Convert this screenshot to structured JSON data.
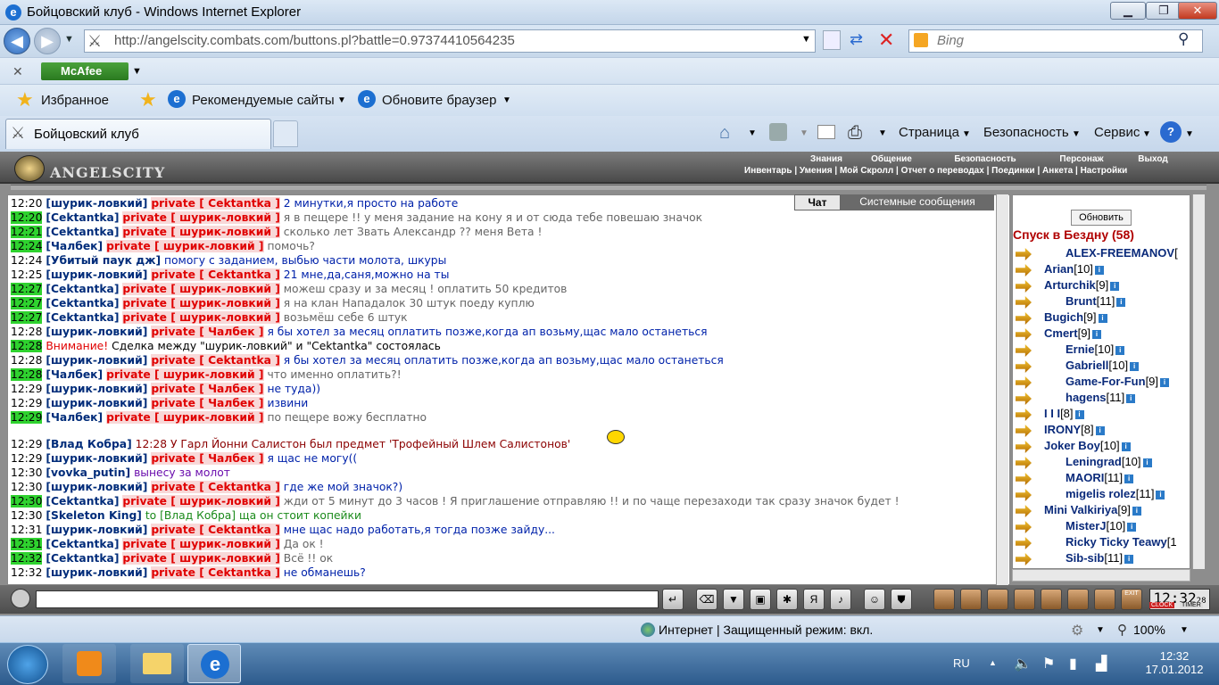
{
  "window": {
    "title": "Бойцовский клуб - Windows Internet Explorer"
  },
  "address": {
    "url": "http://angelscity.combats.com/buttons.pl?battle=0.97374410564235"
  },
  "search": {
    "placeholder": "Bing"
  },
  "toolbars": {
    "mcafee": "McAfee",
    "favorites": "Избранное",
    "suggested": "Рекомендуемые сайты",
    "update": "Обновите браузер"
  },
  "tab": {
    "title": "Бойцовский клуб"
  },
  "commandbar": {
    "page": "Страница",
    "security": "Безопасность",
    "service": "Сервис"
  },
  "game": {
    "logo": "ANGELSCITY",
    "top_menu": [
      "Знания",
      "Общение",
      "Безопасность",
      "Персонаж",
      "Выход"
    ],
    "sub_menu": "Инвентарь | Умения | Мой Скролл | Отчет о переводах | Поединки | Анкета | Настройки",
    "chat_tabs": [
      "Чат",
      "Системные сообщения"
    ],
    "refresh_label": "Обновить",
    "location": "Спуск в Бездну (58)",
    "clock": "12:32",
    "clock_sec": "28",
    "clock_label": "CLOCK",
    "timer_label": "TIMER",
    "exit_label": "EXIT"
  },
  "chat": [
    {
      "time": "12:20",
      "hl": false,
      "nick": "шурик-ловкий",
      "priv": "private [ Cektantka ]",
      "msg": "2 минутки,я просто на работе",
      "cls": "msg-blue"
    },
    {
      "time": "12:20",
      "hl": true,
      "nick": "Cektantka",
      "priv": "private [ шурик-ловкий ]",
      "msg": "я в пещере !! у меня задание на кону я и от сюда тебе повешаю значок",
      "cls": "msg-gray"
    },
    {
      "time": "12:21",
      "hl": true,
      "nick": "Cektantka",
      "priv": "private [ шурик-ловкий ]",
      "msg": "сколько лет Звать Александр ?? меня Вета !",
      "cls": "msg-gray"
    },
    {
      "time": "12:24",
      "hl": true,
      "nick": "Чалбек",
      "priv": "private [ шурик-ловкий ]",
      "msg": "помочь?",
      "cls": "msg-gray"
    },
    {
      "time": "12:24",
      "hl": false,
      "nick": "Убитый паук дж",
      "priv": "",
      "msg": "помогу с заданием, выбью части молота, шкуры",
      "cls": "msg-blue"
    },
    {
      "time": "12:25",
      "hl": false,
      "nick": "шурик-ловкий",
      "priv": "private [ Cektantka ]",
      "msg": "21 мне,да,саня,можно на ты",
      "cls": "msg-blue"
    },
    {
      "time": "12:27",
      "hl": true,
      "nick": "Cektantka",
      "priv": "private [ шурик-ловкий ]",
      "msg": "можеш сразу и за месяц ! оплатить 50 кредитов",
      "cls": "msg-gray"
    },
    {
      "time": "12:27",
      "hl": true,
      "nick": "Cektantka",
      "priv": "private [ шурик-ловкий ]",
      "msg": "я на клан Нападалок 30 штук поеду куплю",
      "cls": "msg-gray"
    },
    {
      "time": "12:27",
      "hl": true,
      "nick": "Cektantka",
      "priv": "private [ шурик-ловкий ]",
      "msg": "возьмёш себе 6 штук",
      "cls": "msg-gray"
    },
    {
      "time": "12:28",
      "hl": false,
      "nick": "шурик-ловкий",
      "priv": "private [ Чалбек ]",
      "msg": "я бы хотел за месяц оплатить позже,когда ап возьму,щас мало останеться",
      "cls": "msg-blue"
    },
    {
      "time": "12:28",
      "hl": true,
      "nick": "",
      "priv": "",
      "sys": "Внимание!",
      "msg": "Сделка между \"шурик-ловкий\" и \"Cektantka\" состоялась",
      "cls": "msg-dark"
    },
    {
      "time": "12:28",
      "hl": false,
      "nick": "шурик-ловкий",
      "priv": "private [ Cektantka ]",
      "msg": "я бы хотел за месяц оплатить позже,когда ап возьму,щас мало останеться",
      "cls": "msg-blue"
    },
    {
      "time": "12:28",
      "hl": true,
      "nick": "Чалбек",
      "priv": "private [ шурик-ловкий ]",
      "msg": "что именно оплатить?!",
      "cls": "msg-gray"
    },
    {
      "time": "12:29",
      "hl": false,
      "nick": "шурик-ловкий",
      "priv": "private [ Чалбек ]",
      "msg": "не туда))",
      "cls": "msg-blue"
    },
    {
      "time": "12:29",
      "hl": false,
      "nick": "шурик-ловкий",
      "priv": "private [ Чалбек ]",
      "msg": "извини",
      "cls": "msg-blue"
    },
    {
      "time": "12:29",
      "hl": true,
      "nick": "Чалбек",
      "priv": "private [ шурик-ловкий ]",
      "msg": "по пещере вожу бесплатно",
      "cls": "msg-gray"
    },
    {
      "time": "12:29",
      "hl": false,
      "nick": "Влад Кобра",
      "priv": "",
      "msg": "12:28 У Гарл Йонни Салистон был предмет 'Трофейный Шлем Салистонов'",
      "cls": "msg-red",
      "gap": true
    },
    {
      "time": "12:29",
      "hl": false,
      "nick": "шурик-ловкий",
      "priv": "private [ Чалбек ]",
      "msg": "я щас не могу((",
      "cls": "msg-blue"
    },
    {
      "time": "12:30",
      "hl": false,
      "nick": "vovka_putin",
      "priv": "",
      "msg": "вынесу за молот",
      "cls": "msg-purple"
    },
    {
      "time": "12:30",
      "hl": false,
      "nick": "шурик-ловкий",
      "priv": "private [ Cektantka ]",
      "msg": "где же мой значок?)",
      "cls": "msg-blue"
    },
    {
      "time": "12:30",
      "hl": true,
      "nick": "Cektantka",
      "priv": "private [ шурик-ловкий ]",
      "msg": "жди от 5 минут до 3 часов ! Я приглашение отправляю !! и по чаще перезаходи так сразу значок будет !",
      "cls": "msg-gray"
    },
    {
      "time": "12:30",
      "hl": false,
      "nick": "Skeleton King",
      "priv": "",
      "msg": "to [Влад Кобра] ща он стоит копейки",
      "cls": "msg-green"
    },
    {
      "time": "12:31",
      "hl": false,
      "nick": "шурик-ловкий",
      "priv": "private [ Cektantka ]",
      "msg": "мне щас надо работать,я тогда позже зайду...",
      "cls": "msg-blue"
    },
    {
      "time": "12:31",
      "hl": true,
      "nick": "Cektantka",
      "priv": "private [ шурик-ловкий ]",
      "msg": "Да ок !",
      "cls": "msg-gray"
    },
    {
      "time": "12:32",
      "hl": true,
      "nick": "Cektantka",
      "priv": "private [ шурик-ловкий ]",
      "msg": "Всё !! ок",
      "cls": "msg-gray"
    },
    {
      "time": "12:32",
      "hl": false,
      "nick": "шурик-ловкий",
      "priv": "private [ Cektantka ]",
      "msg": "не обманешь?",
      "cls": "msg-blue"
    }
  ],
  "players": [
    {
      "name": "ALEX-FREEMANOV",
      "lv": "["
    },
    {
      "name": "Arian",
      "lv": "[10]"
    },
    {
      "name": "Arturchik",
      "lv": "[9]"
    },
    {
      "name": "Brunt",
      "lv": "[11]"
    },
    {
      "name": "Bugich",
      "lv": "[9]"
    },
    {
      "name": "Cmert",
      "lv": "[9]"
    },
    {
      "name": "Ernie",
      "lv": "[10]"
    },
    {
      "name": "Gabriell",
      "lv": "[10]"
    },
    {
      "name": "Game-For-Fun",
      "lv": "[9]"
    },
    {
      "name": "hagens",
      "lv": "[11]"
    },
    {
      "name": "I I I",
      "lv": "[8]"
    },
    {
      "name": "IRONY",
      "lv": "[8]"
    },
    {
      "name": "Joker Boy",
      "lv": "[10]"
    },
    {
      "name": "Leningrad",
      "lv": "[10]"
    },
    {
      "name": "MAORI",
      "lv": "[11]"
    },
    {
      "name": "migelis rolez",
      "lv": "[11]"
    },
    {
      "name": "Mini Valkiriya",
      "lv": "[9]"
    },
    {
      "name": "MisterJ",
      "lv": "[10]"
    },
    {
      "name": "Ricky Ticky Teawy",
      "lv": "[1"
    },
    {
      "name": "Sib-sib",
      "lv": "[11]"
    }
  ],
  "status": {
    "zone": "Интернет | Защищенный режим: вкл.",
    "zoom": "100%"
  },
  "taskbar": {
    "lang": "RU",
    "time": "12:32",
    "date": "17.01.2012"
  }
}
